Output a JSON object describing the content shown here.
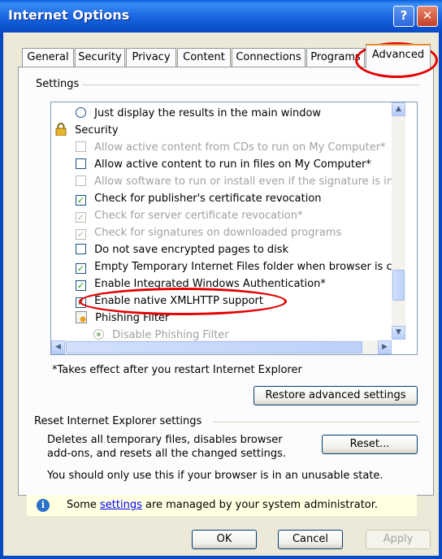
{
  "window": {
    "title": "Internet Options",
    "help_glyph": "?",
    "close_glyph": "✕"
  },
  "tabs": [
    {
      "label": "General"
    },
    {
      "label": "Security"
    },
    {
      "label": "Privacy"
    },
    {
      "label": "Content"
    },
    {
      "label": "Connections"
    },
    {
      "label": "Programs"
    },
    {
      "label": "Advanced",
      "active": true
    }
  ],
  "settings_group": {
    "label": "Settings"
  },
  "settings_list": [
    {
      "type": "radio",
      "label": "Just display the results in the main window",
      "dim": false
    },
    {
      "type": "category",
      "label": "Security"
    },
    {
      "type": "checkbox",
      "label": "Allow active content from CDs to run on My Computer*",
      "checked": false,
      "dim": true
    },
    {
      "type": "checkbox",
      "label": "Allow active content to run in files on My Computer*",
      "checked": false,
      "dim": false
    },
    {
      "type": "checkbox",
      "label": "Allow software to run or install even if the signature is inva",
      "checked": false,
      "dim": true
    },
    {
      "type": "checkbox",
      "label": "Check for publisher's certificate revocation",
      "checked": true,
      "dim": false
    },
    {
      "type": "checkbox",
      "label": "Check for server certificate revocation*",
      "checked": true,
      "dim": true
    },
    {
      "type": "checkbox",
      "label": "Check for signatures on downloaded programs",
      "checked": true,
      "dim": true
    },
    {
      "type": "checkbox",
      "label": "Do not save encrypted pages to disk",
      "checked": false,
      "dim": false
    },
    {
      "type": "checkbox",
      "label": "Empty Temporary Internet Files folder when browser is clo",
      "checked": true,
      "dim": false
    },
    {
      "type": "checkbox",
      "label": "Enable Integrated Windows Authentication*",
      "checked": true,
      "dim": false
    },
    {
      "type": "checkbox",
      "label": "Enable native XMLHTTP support",
      "checked": true,
      "dim": false
    },
    {
      "type": "category",
      "label": "Phishing Filter"
    },
    {
      "type": "radio",
      "label": "Disable Phishing Filter",
      "selected": true,
      "dim": true
    }
  ],
  "footnote": "*Takes effect after you restart Internet Explorer",
  "restore_button": "Restore advanced settings",
  "reset_group": {
    "label": "Reset Internet Explorer settings",
    "description_line1": "Deletes all temporary files, disables browser",
    "description_line2": "add-ons, and resets all the changed settings.",
    "reset_button": "Reset...",
    "warning": "You should only use this if your browser is in an unusable state."
  },
  "info_bar": {
    "prefix": "Some ",
    "link": "settings",
    "suffix": " are managed by your system administrator."
  },
  "footer": {
    "ok": "OK",
    "cancel": "Cancel",
    "apply": "Apply"
  },
  "colors": {
    "titlebar": "#0A5FDC",
    "annotation": "#E40000",
    "dialog": "#ECE9D8",
    "info_bar": "#FFFFE1"
  }
}
